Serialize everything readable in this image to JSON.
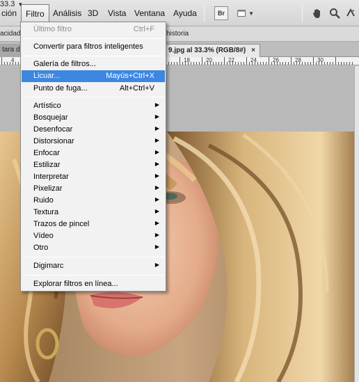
{
  "menubar": {
    "items": [
      "ción",
      "Filtro",
      "Análisis",
      "3D",
      "Vista",
      "Ventana",
      "Ayuda"
    ],
    "bridge_label": "Br",
    "zoom": "33.3",
    "zoom_arrow": "▼",
    "screen_arrow": "▼"
  },
  "options": {
    "opacity": "acidad",
    "history": "historia"
  },
  "tabs": {
    "left_label": "tara d",
    "active_label": "9.jpg al 33.3% (RGB/8#)",
    "close": "×"
  },
  "ruler": {
    "labels": [
      "4",
      "18",
      "20",
      "22",
      "24",
      "26",
      "28",
      "30"
    ]
  },
  "filter_menu": {
    "items": [
      {
        "label": "Último filtro",
        "shortcut": "Ctrl+F",
        "disabled": true
      },
      {
        "label": "Convertir para filtros inteligentes",
        "shortcut": ""
      },
      {
        "label": "Galería de filtros...",
        "shortcut": ""
      },
      {
        "label": "Licuar...",
        "shortcut": "Mayús+Ctrl+X",
        "highlighted": true
      },
      {
        "label": "Punto de fuga...",
        "shortcut": "Alt+Ctrl+V"
      },
      {
        "label": "Artístico",
        "submenu": true
      },
      {
        "label": "Bosquejar",
        "submenu": true
      },
      {
        "label": "Desenfocar",
        "submenu": true
      },
      {
        "label": "Distorsionar",
        "submenu": true
      },
      {
        "label": "Enfocar",
        "submenu": true
      },
      {
        "label": "Estilizar",
        "submenu": true
      },
      {
        "label": "Interpretar",
        "submenu": true
      },
      {
        "label": "Pixelizar",
        "submenu": true
      },
      {
        "label": "Ruido",
        "submenu": true
      },
      {
        "label": "Textura",
        "submenu": true
      },
      {
        "label": "Trazos de pincel",
        "submenu": true
      },
      {
        "label": "Vídeo",
        "submenu": true
      },
      {
        "label": "Otro",
        "submenu": true
      },
      {
        "label": "Digimarc",
        "submenu": true
      },
      {
        "label": "Explorar filtros en línea...",
        "shortcut": ""
      }
    ],
    "submenu_arrow": "▶"
  },
  "colors": {
    "highlight": "#3d87e0",
    "menu_bg": "#f2f2f2",
    "hair_light": "#d9b57a",
    "hair_dark": "#6e4a22",
    "skin": "#e9b99a"
  }
}
